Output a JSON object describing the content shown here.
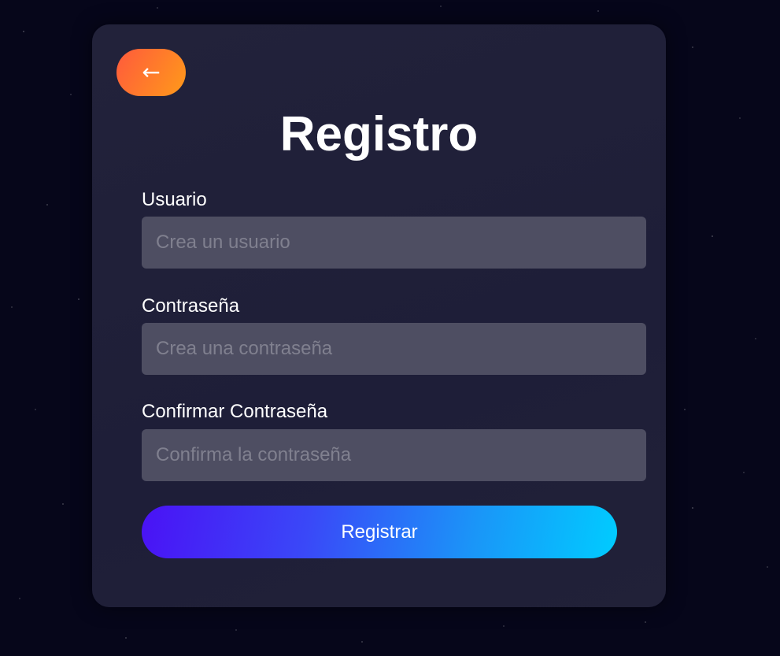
{
  "header": {
    "back_icon": "←",
    "title": "Registro"
  },
  "form": {
    "username": {
      "label": "Usuario",
      "placeholder": "Crea un usuario",
      "value": ""
    },
    "password": {
      "label": "Contraseña",
      "placeholder": "Crea una contraseña",
      "value": ""
    },
    "confirm_password": {
      "label": "Confirmar Contraseña",
      "placeholder": "Confirma la contraseña",
      "value": ""
    },
    "submit_label": "Registrar"
  },
  "theme": {
    "background": "#06061a",
    "card_background": "#20203a",
    "input_background": "#4e4e62",
    "back_button_gradient": [
      "#ff5a3c",
      "#ff9a1a"
    ],
    "submit_gradient": [
      "#4a12f5",
      "#00ccff"
    ]
  }
}
